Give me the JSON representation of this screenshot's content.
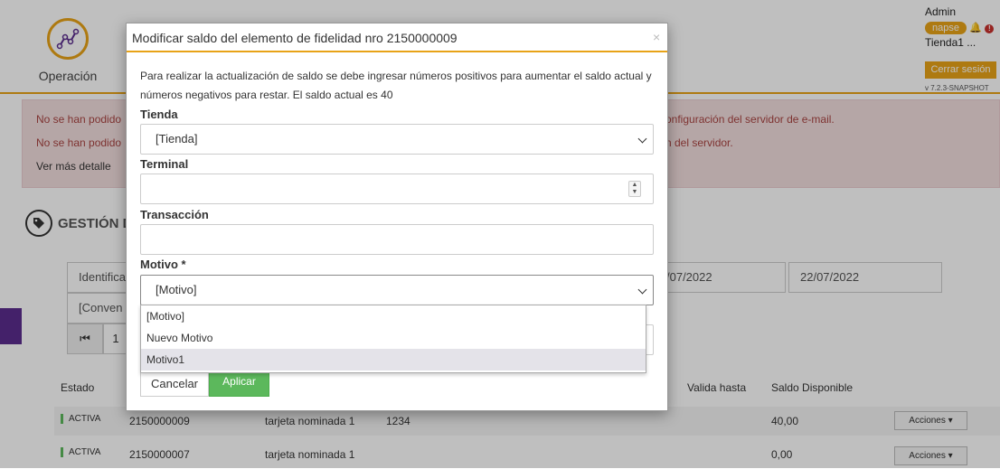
{
  "nav": {
    "operacion_label": "Operación"
  },
  "user": {
    "name": "Admin",
    "brand": "napse",
    "store": "Tienda1 ...",
    "logout": "Cerrar sesión",
    "version": "v 7.2.3-SNAPSHOT"
  },
  "alert": {
    "line1_left": "No se han podido",
    "line1_right": "onfiguración del servidor de e-mail.",
    "line2_left": "No se han podido",
    "line2_right": "n del servidor.",
    "more": "Ver más detalle"
  },
  "section": {
    "title": "GESTIÓN D"
  },
  "filters": {
    "identifica": "Identifica",
    "date_from": "/07/2022",
    "date_to": "22/07/2022",
    "convenio": "[Conven"
  },
  "pager": {
    "page": "1"
  },
  "table": {
    "headers": {
      "estado": "Estado",
      "valida_hasta": "Valida hasta",
      "saldo": "Saldo Disponible"
    },
    "rows": [
      {
        "status": "ACTIVA",
        "number": "2150000009",
        "type": "tarjeta nominada 1",
        "code": "1234",
        "saldo": "40,00",
        "actions": "Acciones"
      },
      {
        "status": "ACTIVA",
        "number": "2150000007",
        "type": "tarjeta nominada 1",
        "code": "",
        "saldo": "0,00",
        "actions": "Acciones"
      }
    ]
  },
  "modal": {
    "title": "Modificar saldo del elemento de fidelidad nro 2150000009",
    "close": "×",
    "description": "Para realizar la actualización de saldo se debe ingresar números positivos para aumentar el saldo actual y números negativos para restar. El saldo actual es 40",
    "tienda": {
      "label": "Tienda",
      "value": "[Tienda]"
    },
    "terminal": {
      "label": "Terminal",
      "value": ""
    },
    "transaccion": {
      "label": "Transacción",
      "value": ""
    },
    "motivo": {
      "label": "Motivo *",
      "value": "[Motivo]",
      "options": [
        "[Motivo]",
        "Nuevo Motivo",
        "Motivo1"
      ]
    },
    "cancel": "Cancelar",
    "apply": "Aplicar"
  },
  "colors": {
    "accent": "#e8a317",
    "success": "#5cb85c",
    "alert_bg": "#f2dede",
    "alert_text": "#a94442"
  }
}
